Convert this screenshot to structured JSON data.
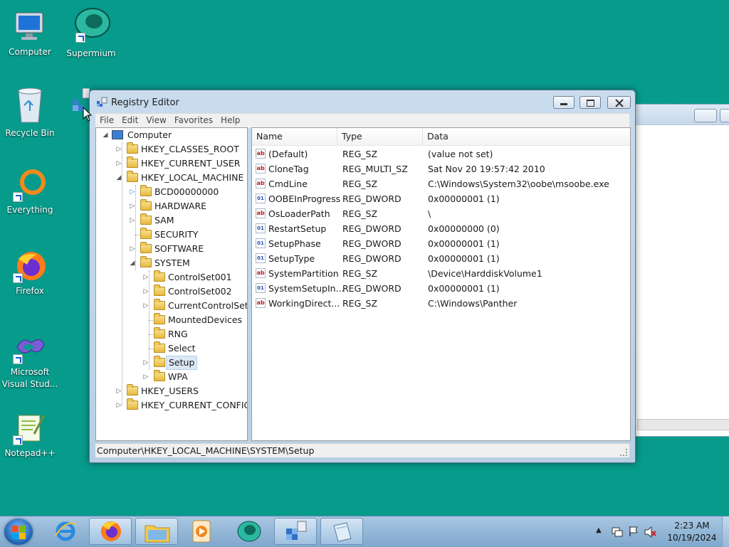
{
  "desktop": {
    "icons": [
      {
        "label": "Computer"
      },
      {
        "label": "Supermium"
      },
      {
        "label": "Recycle Bin"
      },
      {
        "label": "Everything"
      },
      {
        "label": "Firefox"
      },
      {
        "label": "Microsoft Visual Stud..."
      },
      {
        "label": "Notepad++"
      }
    ]
  },
  "window": {
    "title": "Registry Editor",
    "menu": [
      "File",
      "Edit",
      "View",
      "Favorites",
      "Help"
    ],
    "tree": [
      {
        "label": "Computer"
      },
      {
        "label": "HKEY_CLASSES_ROOT"
      },
      {
        "label": "HKEY_CURRENT_USER"
      },
      {
        "label": "HKEY_LOCAL_MACHINE"
      },
      {
        "label": "BCD00000000"
      },
      {
        "label": "HARDWARE"
      },
      {
        "label": "SAM"
      },
      {
        "label": "SECURITY"
      },
      {
        "label": "SOFTWARE"
      },
      {
        "label": "SYSTEM"
      },
      {
        "label": "ControlSet001"
      },
      {
        "label": "ControlSet002"
      },
      {
        "label": "CurrentControlSet"
      },
      {
        "label": "MountedDevices"
      },
      {
        "label": "RNG"
      },
      {
        "label": "Select"
      },
      {
        "label": "Setup"
      },
      {
        "label": "WPA"
      },
      {
        "label": "HKEY_USERS"
      },
      {
        "label": "HKEY_CURRENT_CONFIG"
      }
    ],
    "columns": {
      "name": "Name",
      "type": "Type",
      "data": "Data"
    },
    "values": [
      {
        "name": "(Default)",
        "type": "REG_SZ",
        "data": "(value not set)",
        "icon": "string-value-icon"
      },
      {
        "name": "CloneTag",
        "type": "REG_MULTI_SZ",
        "data": "Sat Nov 20 19:57:42 2010",
        "icon": "string-value-icon"
      },
      {
        "name": "CmdLine",
        "type": "REG_SZ",
        "data": "C:\\Windows\\System32\\oobe\\msoobe.exe",
        "icon": "string-value-icon"
      },
      {
        "name": "OOBEInProgress",
        "type": "REG_DWORD",
        "data": "0x00000001 (1)",
        "icon": "binary-value-icon"
      },
      {
        "name": "OsLoaderPath",
        "type": "REG_SZ",
        "data": "\\",
        "icon": "string-value-icon"
      },
      {
        "name": "RestartSetup",
        "type": "REG_DWORD",
        "data": "0x00000000 (0)",
        "icon": "binary-value-icon"
      },
      {
        "name": "SetupPhase",
        "type": "REG_DWORD",
        "data": "0x00000001 (1)",
        "icon": "binary-value-icon"
      },
      {
        "name": "SetupType",
        "type": "REG_DWORD",
        "data": "0x00000001 (1)",
        "icon": "binary-value-icon"
      },
      {
        "name": "SystemPartition",
        "type": "REG_SZ",
        "data": "\\Device\\HarddiskVolume1",
        "icon": "string-value-icon"
      },
      {
        "name": "SystemSetupIn...",
        "type": "REG_DWORD",
        "data": "0x00000001 (1)",
        "icon": "binary-value-icon"
      },
      {
        "name": "WorkingDirect...",
        "type": "REG_SZ",
        "data": "C:\\Windows\\Panther",
        "icon": "string-value-icon"
      }
    ],
    "status": "Computer\\HKEY_LOCAL_MACHINE\\SYSTEM\\Setup"
  },
  "taskbar": {
    "time": "2:23 AM",
    "date": "10/19/2024"
  }
}
